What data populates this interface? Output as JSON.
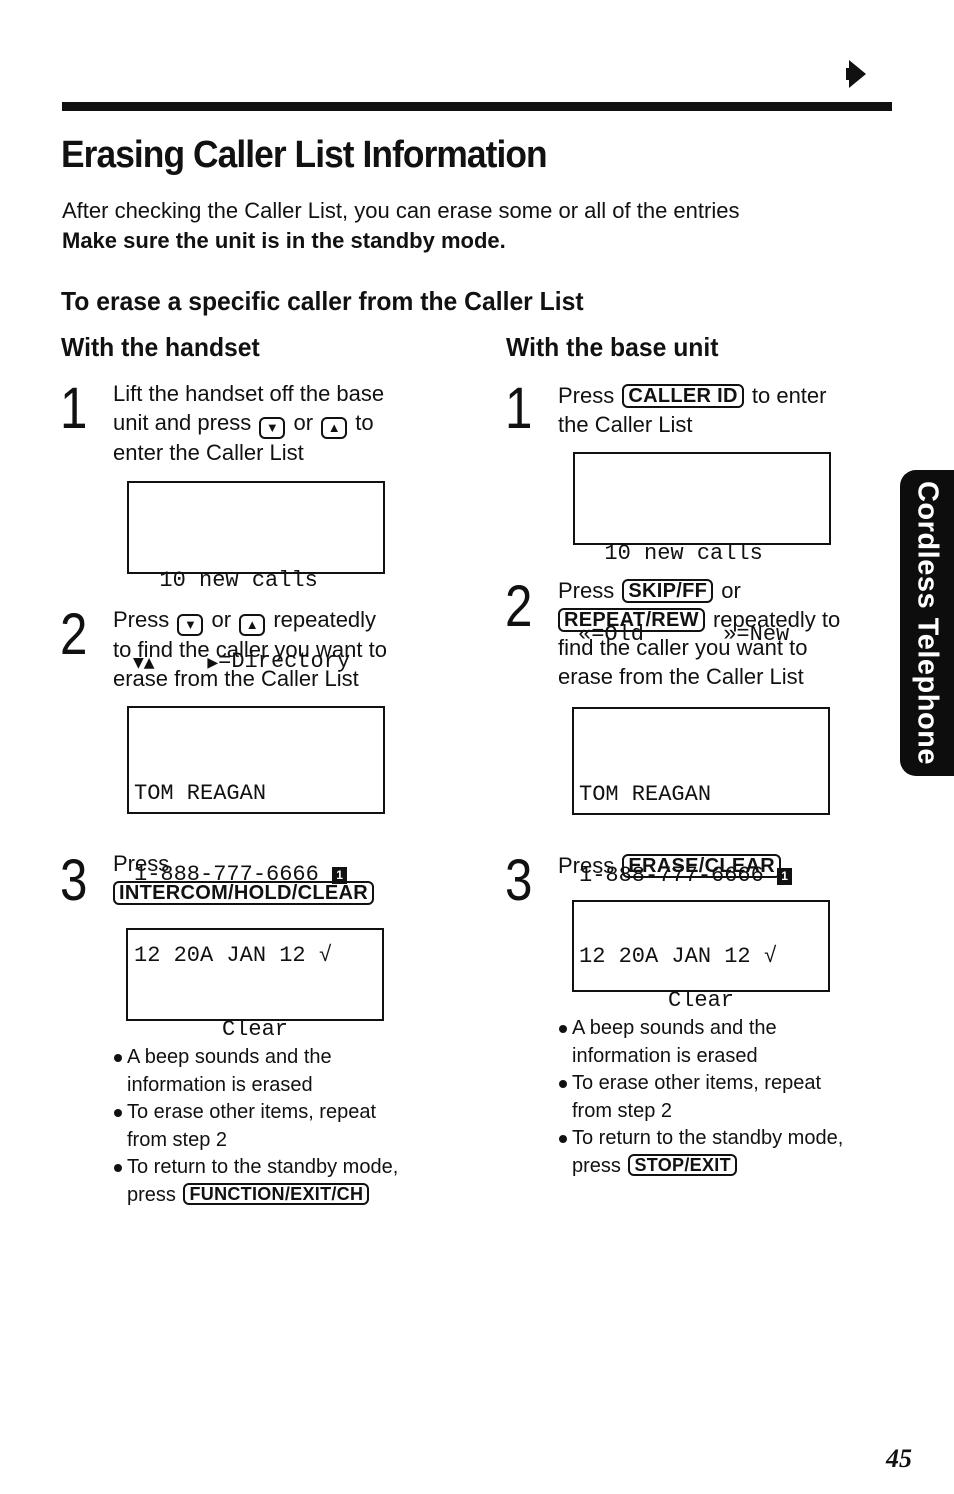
{
  "page": {
    "title": "Erasing Caller List Information",
    "intro_text": "After checking the Caller List, you can erase some or all of the entries",
    "intro_note": "Make sure the unit is in the standby mode.",
    "section_heading": "To erase a specific caller from the Caller List",
    "side_tab_label": "Cordless Telephone",
    "page_number": "45",
    "continue_icon": "right-arrow-icon"
  },
  "handset": {
    "heading": "With the handset",
    "step1": {
      "num": "1",
      "line1": "Lift the handset off the base",
      "line2_pre": "unit and press",
      "down_key": "▼",
      "or": "or",
      "up_key": "▲",
      "line2_post": "to",
      "line3": "enter the Caller List",
      "display": {
        "line1": "  10 new calls",
        "line2_keys": "▼▲",
        "line2_pad": "    ",
        "line2_arrow": "▶",
        "line2_text": "=Directory"
      }
    },
    "step2": {
      "num": "2",
      "press": "Press",
      "down_key": "▼",
      "or": "or",
      "up_key": "▲",
      "line1_post": "repeatedly",
      "line2": "to find the caller you want to",
      "line3": "erase from the Caller List",
      "display": {
        "name": "TOM REAGAN",
        "number": "1-888-777-6666 ",
        "badge": "1",
        "datetime": "12 20A JAN 12 √"
      }
    },
    "step3": {
      "num": "3",
      "press": "Press",
      "key": "INTERCOM/HOLD/CLEAR",
      "display": {
        "text": "Clear"
      }
    },
    "notes": {
      "n1a": "A beep sounds and the",
      "n1b": "information is erased",
      "n2a": "To erase other items, repeat",
      "n2b": "from step 2",
      "n3a": "To return to the standby mode,",
      "n3b": "press",
      "n3_key": "FUNCTION/EXIT/CH"
    }
  },
  "base": {
    "heading": "With the base unit",
    "step1": {
      "num": "1",
      "press": "Press",
      "key": "CALLER ID",
      "line1_post": "to enter",
      "line2": "the Caller List",
      "display": {
        "line1": "  10 new calls",
        "line2": "«=Old      »=New"
      }
    },
    "step2": {
      "num": "2",
      "press": "Press",
      "key1": "SKIP/FF",
      "or": "or",
      "key2": "REPEAT/REW",
      "line2_post": "repeatedly to",
      "line3": "find the caller you want to",
      "line4": "erase from the Caller List",
      "display": {
        "name": "TOM REAGAN",
        "number": "1-888-777-6666 ",
        "badge": "1",
        "datetime": "12 20A JAN 12 √"
      }
    },
    "step3": {
      "num": "3",
      "press": "Press",
      "key": "ERASE/CLEAR",
      "display": {
        "text": "Clear"
      }
    },
    "notes": {
      "n1a": "A beep sounds and the",
      "n1b": "information is erased",
      "n2a": "To erase other items, repeat",
      "n2b": "from step 2",
      "n3a": "To return to the standby mode,",
      "n3b": "press",
      "n3_key": "STOP/EXIT"
    }
  }
}
